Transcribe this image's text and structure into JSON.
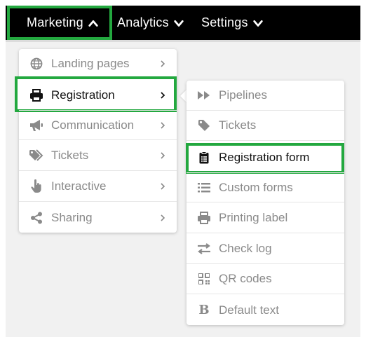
{
  "nav": {
    "items": [
      {
        "label": "Marketing",
        "state": "open"
      },
      {
        "label": "Analytics",
        "state": "closed"
      },
      {
        "label": "Settings",
        "state": "closed"
      }
    ]
  },
  "menu1": {
    "items": [
      {
        "label": "Landing pages",
        "icon": "globe-icon"
      },
      {
        "label": "Registration",
        "icon": "printer-icon"
      },
      {
        "label": "Communication",
        "icon": "megaphone-icon"
      },
      {
        "label": "Tickets",
        "icon": "tags-icon"
      },
      {
        "label": "Interactive",
        "icon": "hand-pointer-icon"
      },
      {
        "label": "Sharing",
        "icon": "share-icon"
      }
    ]
  },
  "menu2": {
    "items": [
      {
        "label": "Pipelines",
        "icon": "fast-forward-icon"
      },
      {
        "label": "Tickets",
        "icon": "tag-icon"
      },
      {
        "label": "Registration form",
        "icon": "clipboard-list-icon"
      },
      {
        "label": "Custom forms",
        "icon": "list-icon"
      },
      {
        "label": "Printing label",
        "icon": "printer-icon"
      },
      {
        "label": "Check log",
        "icon": "exchange-icon"
      },
      {
        "label": "QR codes",
        "icon": "qrcode-icon"
      },
      {
        "label": "Default text",
        "icon": "bold-icon"
      }
    ]
  },
  "colors": {
    "highlight": "#23a83f",
    "topbar": "#000000",
    "muted_text": "#8a8a8a"
  }
}
